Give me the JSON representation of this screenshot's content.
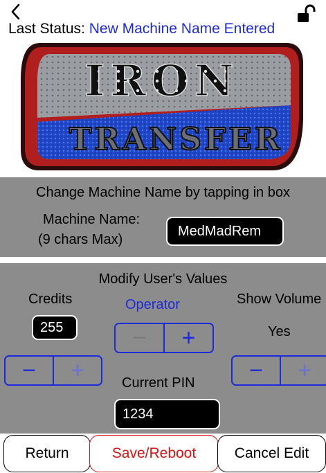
{
  "header": {
    "back_icon": "chevron-left-icon",
    "lock_icon": "unlocked-padlock-icon",
    "status_label": "Last Status:",
    "status_value": "New Machine Name Entered",
    "status_color": "#1d2bd9"
  },
  "logo": {
    "line1": "IRON",
    "line2": "TRANSFER"
  },
  "name_section": {
    "title": "Change Machine Name by tapping in box",
    "label_line1": "Machine Name:",
    "label_line2": "(9 chars Max)",
    "value": "MedMadRem"
  },
  "values_section": {
    "title": "Modify User's Values",
    "credits": {
      "label": "Credits",
      "value": "255"
    },
    "operator": {
      "label": "Operator"
    },
    "show_volume": {
      "label": "Show Volume",
      "value": "Yes"
    },
    "pin": {
      "label": "Current PIN",
      "value": "1234"
    },
    "stepper_minus": "−",
    "stepper_plus": "+"
  },
  "buttons": {
    "return": "Return",
    "save": "Save/Reboot",
    "cancel": "Cancel Edit"
  },
  "colors": {
    "accent": "#1d2bd9",
    "panel": "#8c8c8c",
    "danger": "#dd1111"
  }
}
